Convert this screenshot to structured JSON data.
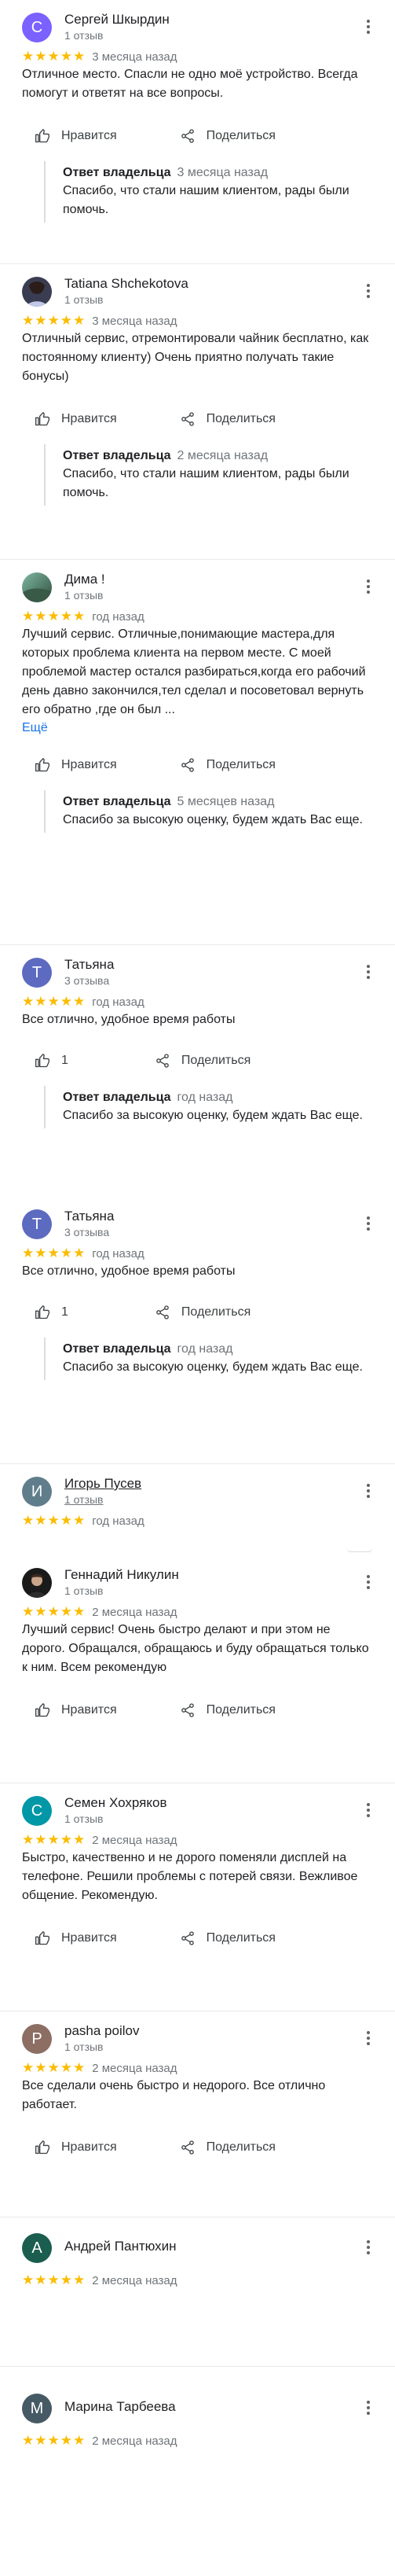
{
  "labels": {
    "like": "Нравится",
    "share": "Поделиться",
    "owner_reply": "Ответ владельца",
    "more": "Ещё"
  },
  "colors": {
    "star": "#fbbc04",
    "link": "#1a73e8",
    "avatar_c_purple": "#7b61ff",
    "avatar_t_blue": "#5c6bc0",
    "avatar_i_gray": "#607d8b",
    "avatar_c_teal": "#0097a7",
    "avatar_p_brown": "#8d6e63",
    "avatar_a_green": "#1b5e4f",
    "avatar_m_slate": "#455a64"
  },
  "reviews": [
    {
      "name": "Сергей Шкырдин",
      "count": "1 отзыв",
      "avatar_letter": "С",
      "stars": "★★★★★",
      "date": "3 месяца назад",
      "text": "Отличное место.  Спасли не одно моё устройство. Всегда помогут и ответят на все вопросы.",
      "likes": "",
      "reply_date": "3 месяца назад",
      "reply_text": "Спасибо, что стали нашим клиентом, рады были помочь."
    },
    {
      "name": "Tatiana Shchekotova",
      "count": "1 отзыв",
      "avatar_letter": "",
      "stars": "★★★★★",
      "date": "3 месяца назад",
      "text": "Отличный сервис, отремонтировали чайник бесплатно, как постоянному клиенту) Очень приятно получать такие бонусы)",
      "likes": "",
      "reply_date": "2 месяца назад",
      "reply_text": "Спасибо, что стали нашим клиентом, рады были помочь."
    },
    {
      "name": "Дима !",
      "count": "1 отзыв",
      "avatar_letter": "",
      "stars": "★★★★★",
      "date": "год назад",
      "text": "Лучший сервис. Отличные,понимающие мастера,для которых проблема клиента на первом месте. С моей проблемой мастер остался разбираться,когда его рабочий день давно закончился,тел сделал и посоветовал вернуть его обратно ,где он был ...",
      "likes": "",
      "reply_date": "5 месяцев назад",
      "reply_text": "Спасибо за высокую оценку, будем ждать Вас еще."
    },
    {
      "name": "Татьяна",
      "count": "3 отзыва",
      "avatar_letter": "Т",
      "stars": "★★★★★",
      "date": "год назад",
      "text": "Все отлично, удобное время работы",
      "likes": "1",
      "reply_date": "год назад",
      "reply_text": "Спасибо за высокую оценку, будем ждать Вас еще."
    },
    {
      "name": "Татьяна",
      "count": "3 отзыва",
      "avatar_letter": "Т",
      "stars": "★★★★★",
      "date": "год назад",
      "text": "Все отлично, удобное время работы",
      "likes": "1",
      "reply_date": "год назад",
      "reply_text": "Спасибо за высокую оценку, будем ждать Вас еще."
    },
    {
      "name": "Игорь Пусев",
      "count": "1 отзыв",
      "avatar_letter": "И",
      "stars": "★★★★★",
      "date": "год назад"
    },
    {
      "name": "Геннадий Никулин",
      "count": "1 отзыв",
      "avatar_letter": "",
      "stars": "★★★★★",
      "date": "2 месяца назад",
      "text": "Лучший сервис! Очень быстро делают и при этом не дорого. Обращался, обращаюсь и буду обращаться только к ним. Всем рекомендую",
      "likes": ""
    },
    {
      "name": "Семен Хохряков",
      "count": "1 отзыв",
      "avatar_letter": "С",
      "stars": "★★★★★",
      "date": "2 месяца назад",
      "text": "Быстро, качественно и не дорого поменяли дисплей на телефоне. Решили проблемы с потерей связи. Вежливое общение. Рекомендую.",
      "likes": ""
    },
    {
      "name": "pasha poilov",
      "count": "1 отзыв",
      "avatar_letter": "P",
      "stars": "★★★★★",
      "date": "2 месяца назад",
      "text": "Все сделали очень быстро и недорого. Все отлично работает.",
      "likes": ""
    },
    {
      "name": "Андрей Пантюхин",
      "count": "",
      "avatar_letter": "А",
      "stars": "★★★★★",
      "date": "2 месяца назад"
    },
    {
      "name": "Марина Тарбеева",
      "count": "",
      "avatar_letter": "М",
      "stars": "★★★★★",
      "date": "2 месяца назад"
    }
  ]
}
